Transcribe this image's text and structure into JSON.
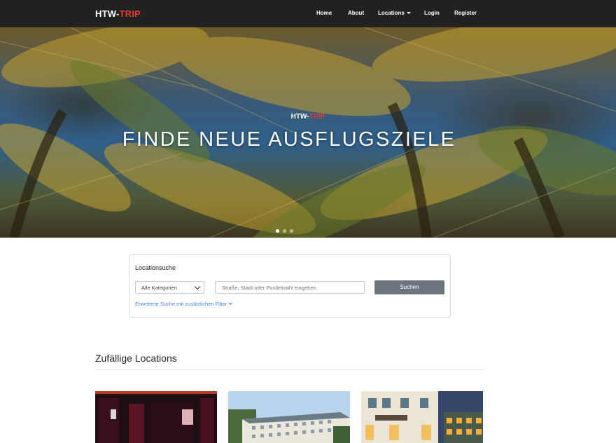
{
  "navbar": {
    "brand": {
      "part1": "HTW-",
      "part2": "TRIP"
    },
    "links": {
      "home": "Home",
      "about": "About",
      "locations": "Locations",
      "login": "Login",
      "register": "Register"
    }
  },
  "hero": {
    "kicker": {
      "part1": "HTW-",
      "part2": "TRIP"
    },
    "title": "FINDE NEUE AUSFLUGSZIELE",
    "slides_total": 3,
    "active_slide": 1
  },
  "search": {
    "title": "Locationsuche",
    "category_selected": "Alle Kategorien",
    "address_placeholder": "Straße, Stadt oder Postleitzahl eingeben",
    "button_label": "Suchen",
    "advanced_link": "Erweiterte Suche mit zusätzlichen Filter"
  },
  "random_locations": {
    "heading": "Zufällige Locations",
    "cards": [
      {
        "image": "bar-interior-photo"
      },
      {
        "image": "hotel-building-photo"
      },
      {
        "image": "restaurant-building-photo"
      }
    ]
  },
  "colors": {
    "navbar_bg": "#212121",
    "brand_accent": "#e53935",
    "button_bg": "#6c757d",
    "link": "#3b82f6"
  }
}
